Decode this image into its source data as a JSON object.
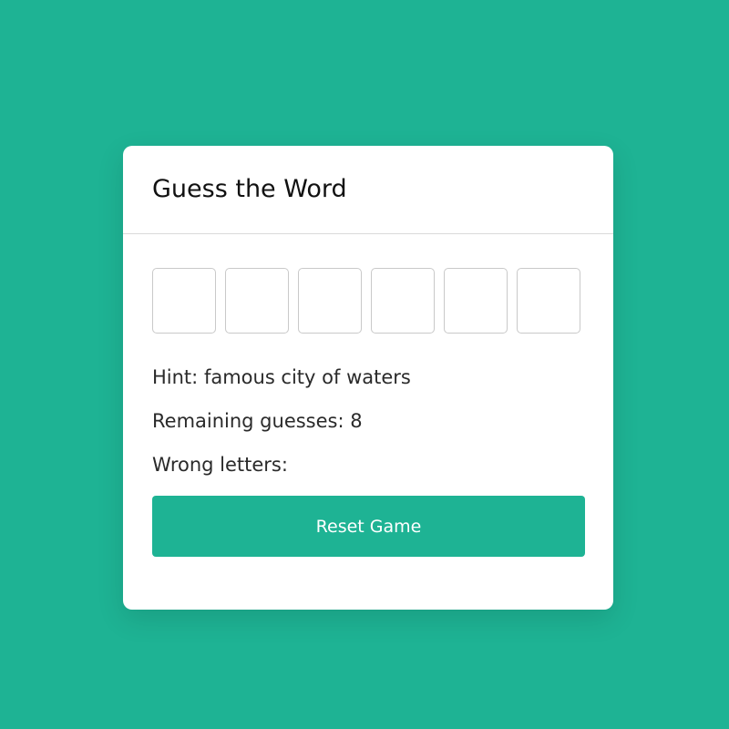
{
  "app": {
    "title": "Guess the Word"
  },
  "word_inputs": [
    "",
    "",
    "",
    "",
    "",
    ""
  ],
  "details": {
    "hint_label": "Hint:",
    "hint_value": "famous city of waters",
    "remaining_label": "Remaining guesses:",
    "remaining_value": "8",
    "wrong_label": "Wrong letters:",
    "wrong_value": ""
  },
  "actions": {
    "reset_label": "Reset Game"
  },
  "colors": {
    "background": "#1eb394",
    "accent": "#1eb394",
    "card": "#ffffff"
  }
}
